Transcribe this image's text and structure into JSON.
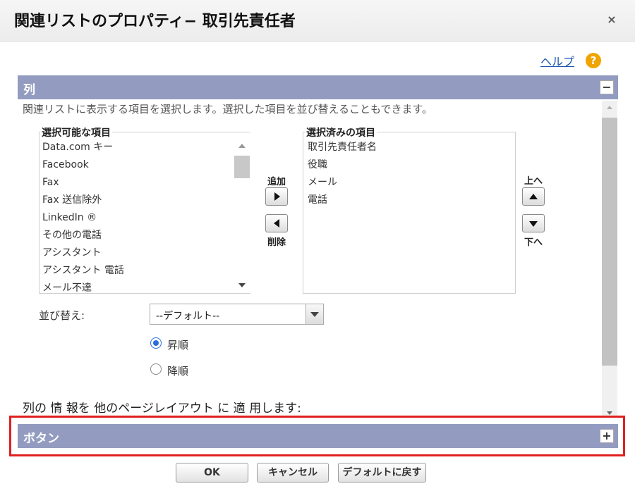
{
  "dialog": {
    "title": "関連リストのプロパティ− 取引先責任者",
    "close_label": "×",
    "help_label": "ヘルプ",
    "help_icon": "?"
  },
  "columns_section": {
    "title": "列",
    "toggle": "−",
    "instruction": "関連リストに表示する項目を選択します。選択した項目を並び替えることもできます。",
    "available_label": "選択可能な項目",
    "available_items": [
      "Data.com キー",
      "Facebook",
      "Fax",
      "Fax 送信除外",
      "LinkedIn ®",
      "その他の電話",
      "アシスタント",
      "アシスタント 電話",
      "メール不達"
    ],
    "add_label": "追加",
    "remove_label": "削除",
    "selected_label": "選択済みの項目",
    "selected_items": [
      "取引先責任者名",
      "役職",
      "メール",
      "電話"
    ],
    "up_label": "上へ",
    "down_label": "下へ",
    "sort_label": "並び替え:",
    "sort_value": "--デフォルト--",
    "asc_label": "昇順",
    "desc_label": "降順",
    "sort_order": "asc",
    "apply_label": "列の 情 報を 他のページレイアウト に 適 用します:"
  },
  "buttons_section": {
    "title": "ボタン",
    "toggle": "+"
  },
  "footer": {
    "ok_label": "OK",
    "cancel_label": "キャンセル",
    "default_label": "デフォルトに戻す"
  },
  "colors": {
    "section_bar": "#939cc0",
    "highlight_box": "#e0201f",
    "help_icon": "#f0a400"
  }
}
